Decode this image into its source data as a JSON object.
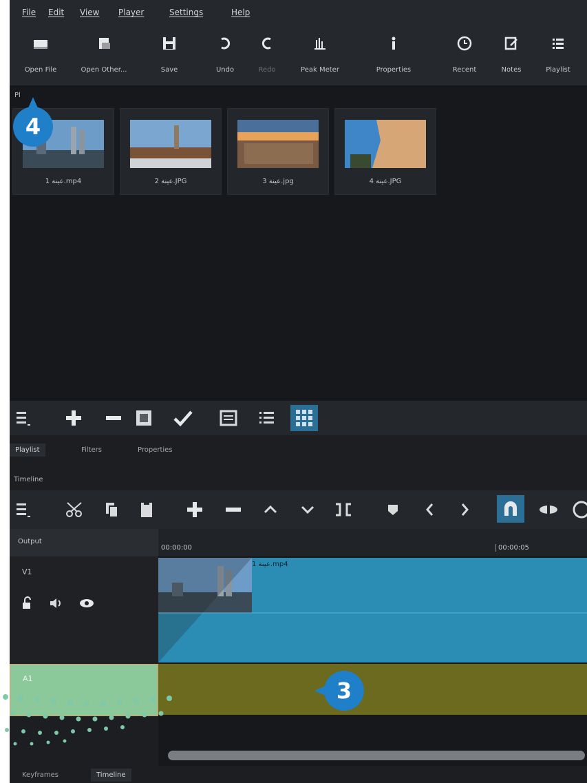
{
  "menu": [
    "File",
    "Edit",
    "View",
    "Player",
    "Settings",
    "Help"
  ],
  "toolbar": [
    {
      "label": "Open File",
      "icon": "open-file-icon",
      "enabled": true
    },
    {
      "label": "Open Other...",
      "icon": "open-other-icon",
      "enabled": true
    },
    {
      "label": "Save",
      "icon": "save-icon",
      "enabled": true
    },
    {
      "label": "Undo",
      "icon": "undo-icon",
      "enabled": true
    },
    {
      "label": "Redo",
      "icon": "redo-icon",
      "enabled": false
    },
    {
      "label": "Peak Meter",
      "icon": "peak-meter-icon",
      "enabled": true
    },
    {
      "label": "Properties",
      "icon": "info-icon",
      "enabled": true
    },
    {
      "label": "Recent",
      "icon": "clock-icon",
      "enabled": true
    },
    {
      "label": "Notes",
      "icon": "notes-icon",
      "enabled": true
    },
    {
      "label": "Playlist",
      "icon": "list-icon",
      "enabled": true
    }
  ],
  "playlist": {
    "title": "Pl",
    "items": [
      {
        "label": "1 عينة.mp4"
      },
      {
        "label": "2 عينة.JPG"
      },
      {
        "label": "3 عينة.jpg"
      },
      {
        "label": "4 عينة.JPG"
      }
    ],
    "tabs": [
      "Playlist",
      "Filters",
      "Properties"
    ]
  },
  "timeline": {
    "title": "Timeline",
    "output_label": "Output",
    "tracks": [
      "V1",
      "A1"
    ],
    "ruler_ticks": [
      "00:00:00",
      "00:00:05"
    ],
    "clip_name": "عينة 1.mp4"
  },
  "bottom_tabs": [
    "Keyframes",
    "Timeline"
  ],
  "callouts": [
    "4",
    "3"
  ],
  "colors": {
    "accent": "#1f7fc8",
    "video_track": "#2b8db3",
    "audio_track": "#6b6a1f",
    "selected_track": "#8cc99a"
  }
}
